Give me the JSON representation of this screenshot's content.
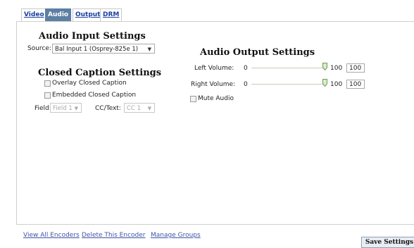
{
  "tabs": [
    {
      "label": "Video",
      "active": false
    },
    {
      "label": "Audio",
      "active": true
    },
    {
      "label": "Output",
      "active": false
    },
    {
      "label": "DRM",
      "active": false
    }
  ],
  "audio_input": {
    "heading": "Audio Input Settings",
    "source_label": "Source:",
    "source_value": "Bal Input 1 (Osprey-825e 1)"
  },
  "closed_caption": {
    "heading": "Closed Caption Settings",
    "overlay_label": "Overlay Closed Caption",
    "embedded_label": "Embedded Closed Caption",
    "field_label": "Field:",
    "field_value": "Field 1",
    "cc_label": "CC/Text:",
    "cc_value": "CC 1"
  },
  "audio_output": {
    "heading": "Audio Output Settings",
    "left": {
      "label": "Left Volume:",
      "min": "0",
      "max": "100",
      "value": "100"
    },
    "right": {
      "label": "Right Volume:",
      "min": "0",
      "max": "100",
      "value": "100"
    },
    "mute_label": "Mute Audio"
  },
  "footer": {
    "view_all": "View All Encoders",
    "delete": "Delete This Encoder",
    "manage": "Manage Groups",
    "save": "Save Settings"
  },
  "colors": {
    "accent": "#5d7fa3",
    "link": "#3f54a7"
  }
}
